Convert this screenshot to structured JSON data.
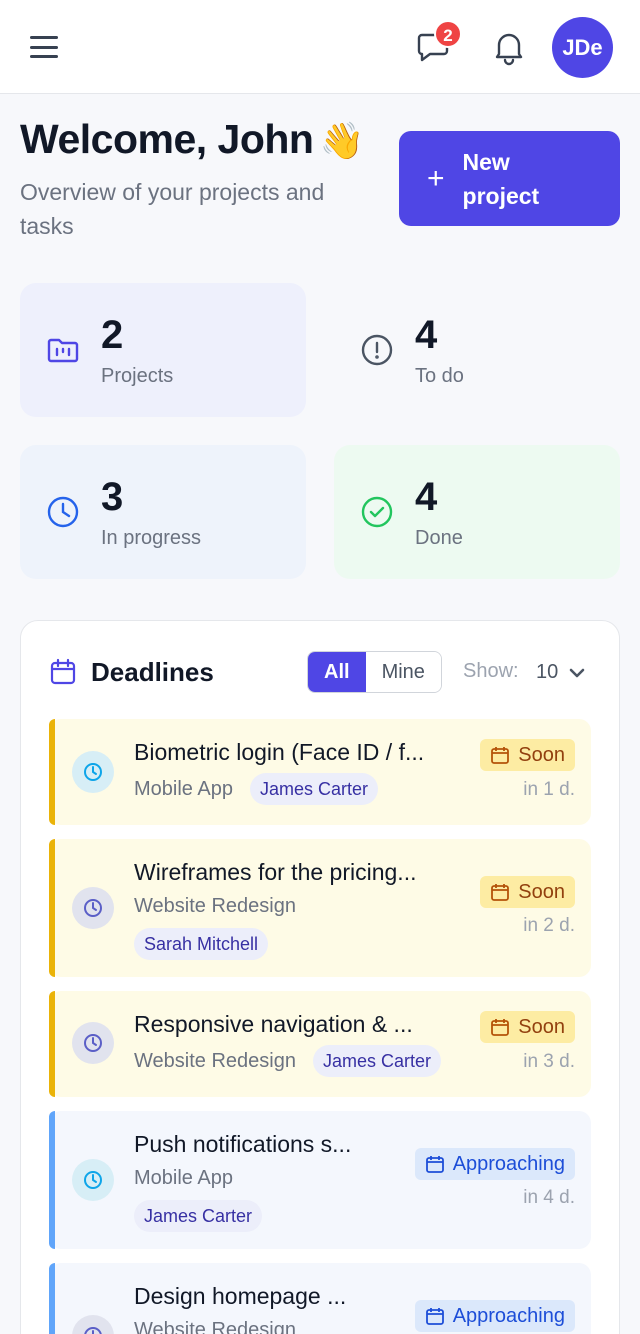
{
  "header": {
    "chat_badge": "2",
    "avatar_initials": "JDe",
    "icons": [
      "menu-icon",
      "chat-icon",
      "bell-icon"
    ]
  },
  "welcome": {
    "title": "Welcome, John",
    "emoji": "👋",
    "subtitle": "Overview of your projects and tasks",
    "new_project_label": "New project",
    "new_project_icon": "+"
  },
  "stats": [
    {
      "value": "2",
      "label": "Projects",
      "icon": "folder-icon",
      "color": "#4f46e5"
    },
    {
      "value": "4",
      "label": "To do",
      "icon": "alert-circle-icon",
      "color": "#4b5563"
    },
    {
      "value": "3",
      "label": "In progress",
      "icon": "clock-icon",
      "color": "#2563eb"
    },
    {
      "value": "4",
      "label": "Done",
      "icon": "check-circle-icon",
      "color": "#22c55e"
    }
  ],
  "deadlines": {
    "title": "Deadlines",
    "filter_all": "All",
    "filter_mine": "Mine",
    "show_label": "Show:",
    "show_value": "10",
    "items": [
      {
        "title": "Biometric login (Face ID / f...",
        "project": "Mobile App",
        "assignee": "James Carter",
        "status": "Soon",
        "due": "in 1 d."
      },
      {
        "title": "Wireframes for the pricing...",
        "project": "Website Redesign",
        "assignee": "Sarah Mitchell",
        "status": "Soon",
        "due": "in 2 d."
      },
      {
        "title": "Responsive navigation & ...",
        "project": "Website Redesign",
        "assignee": "James Carter",
        "status": "Soon",
        "due": "in 3 d."
      },
      {
        "title": "Push notifications s...",
        "project": "Mobile App",
        "assignee": "James Carter",
        "status": "Approaching",
        "due": "in 4 d."
      },
      {
        "title": "Design homepage ...",
        "project": "Website Redesign",
        "assignee": "",
        "status": "Approaching",
        "due": ""
      }
    ]
  },
  "colors": {
    "primary": "#4f46e5",
    "soon_bar": "#eab308",
    "approaching_bar": "#60a5fa",
    "badge": "#ef4444"
  }
}
